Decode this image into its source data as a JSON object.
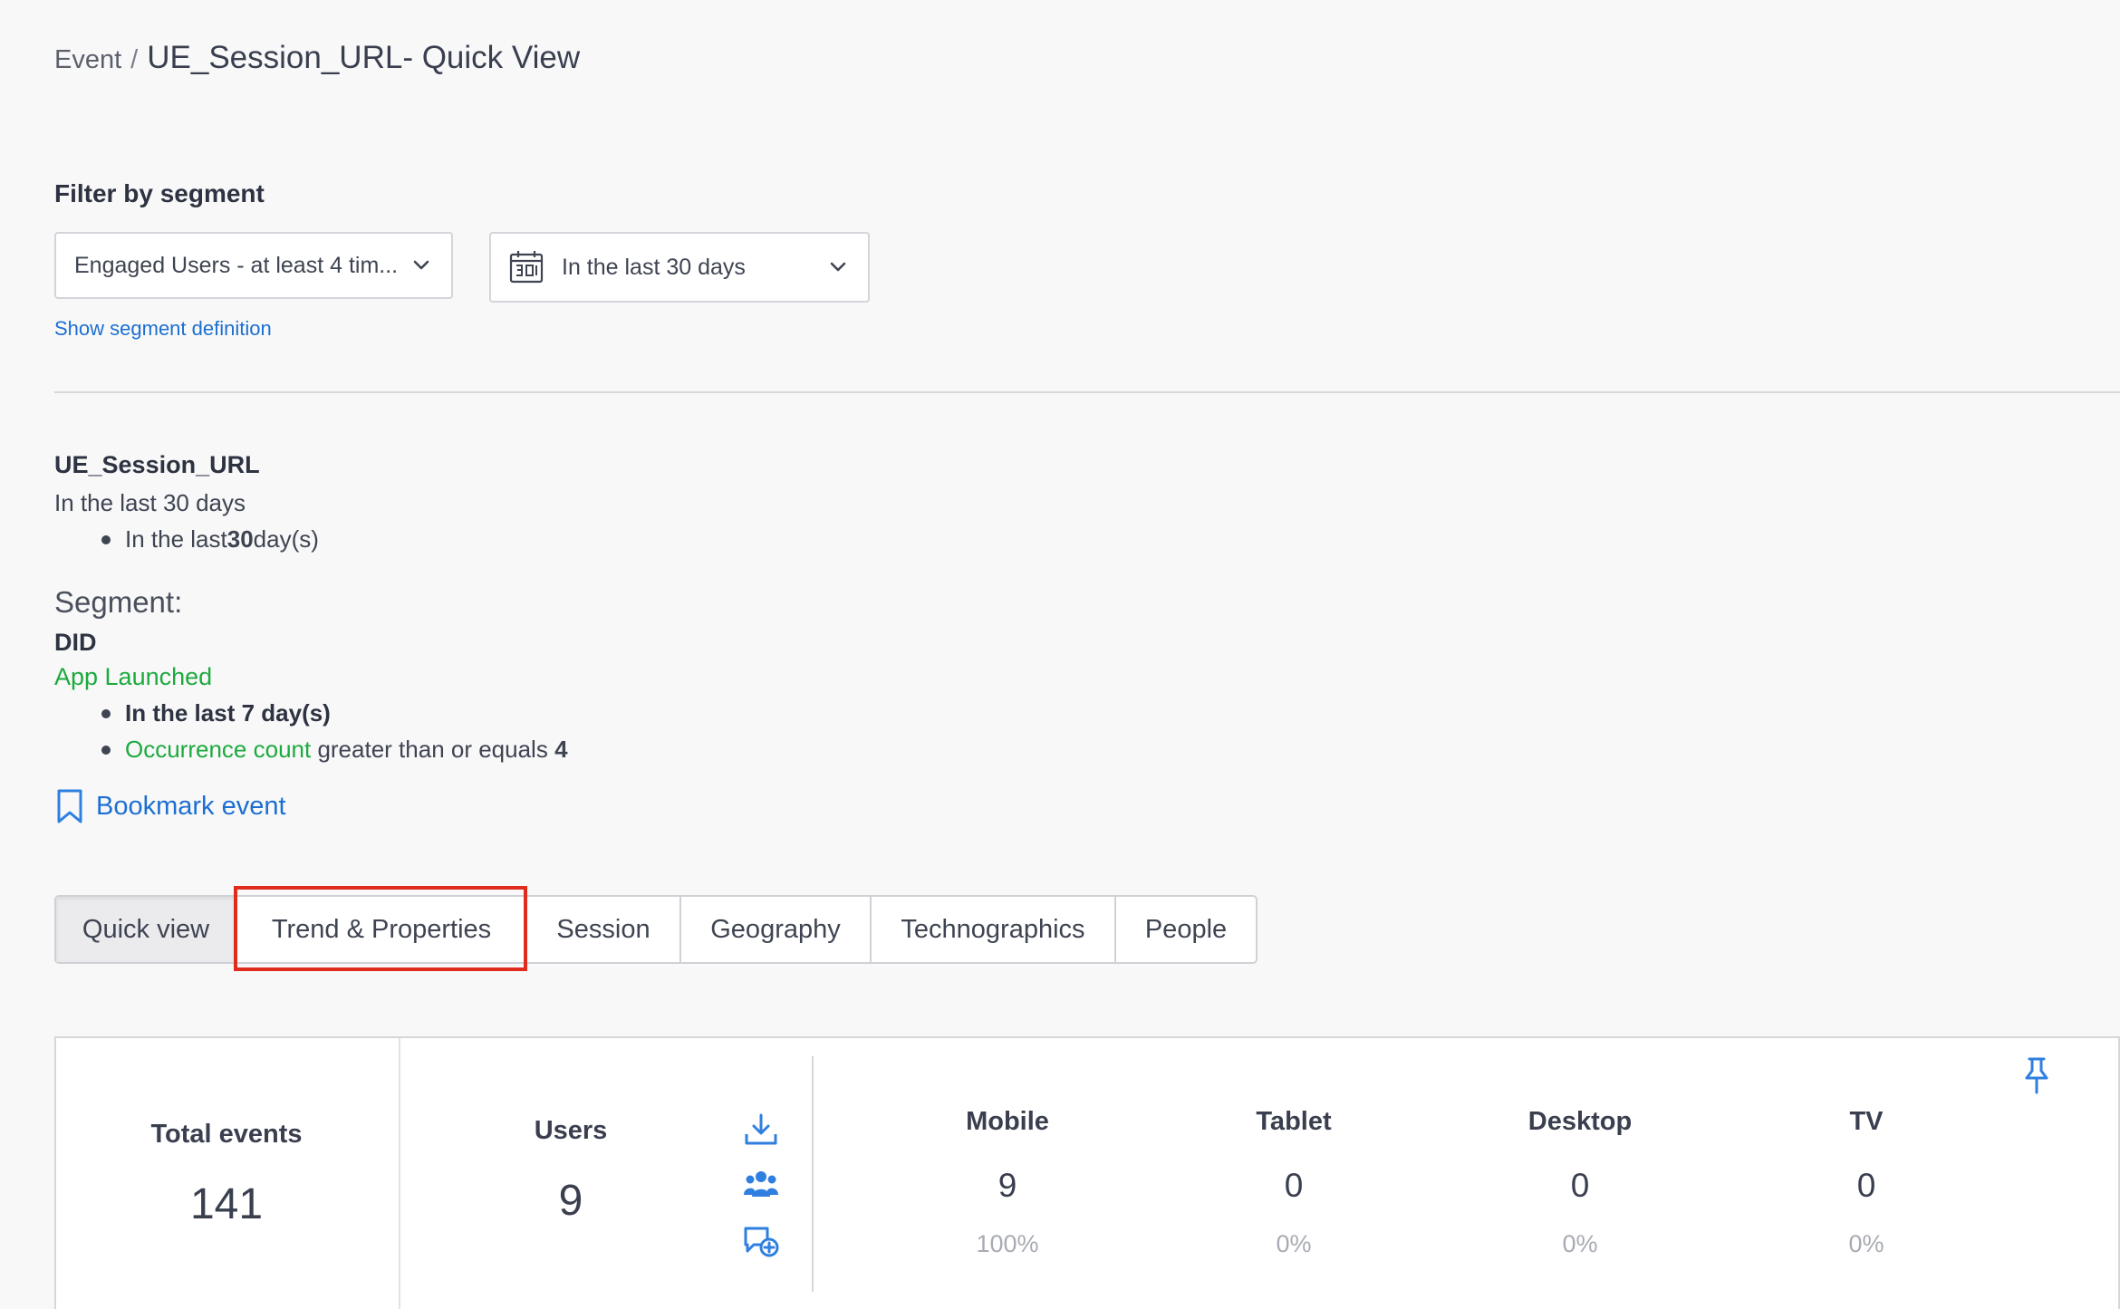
{
  "breadcrumb": {
    "root": "Event",
    "separator": "/",
    "title": "UE_Session_URL- Quick View"
  },
  "filter": {
    "label": "Filter by segment",
    "segment_value": "Engaged Users - at least 4 tim...",
    "date_value": "In the last 30 days",
    "segment_definition_link": "Show segment definition"
  },
  "event_summary": {
    "name": "UE_Session_URL",
    "range": "In the last 30 days",
    "range_detail_prefix": "In the last ",
    "range_detail_number": "30",
    "range_detail_suffix": " day(s)"
  },
  "segment": {
    "heading": "Segment:",
    "condition": "DID",
    "event": "App Launched",
    "time_rule": "In the last 7 day(s)",
    "count_label": "Occurrence count",
    "count_operator": " greater than or equals ",
    "count_value": "4"
  },
  "bookmark": {
    "label": "Bookmark event",
    "icon": "bookmark-icon"
  },
  "tabs": [
    {
      "label": "Quick view",
      "active": true
    },
    {
      "label": "Trend & Properties",
      "active": false
    },
    {
      "label": "Session",
      "active": false
    },
    {
      "label": "Geography",
      "active": false
    },
    {
      "label": "Technographics",
      "active": false
    },
    {
      "label": "People",
      "active": false
    }
  ],
  "stats": {
    "total_events": {
      "label": "Total events",
      "value": "141"
    },
    "users": {
      "label": "Users",
      "value": "9"
    },
    "devices": [
      {
        "label": "Mobile",
        "value": "9",
        "percent": "100%"
      },
      {
        "label": "Tablet",
        "value": "0",
        "percent": "0%"
      },
      {
        "label": "Desktop",
        "value": "0",
        "percent": "0%"
      },
      {
        "label": "TV",
        "value": "0",
        "percent": "0%"
      }
    ]
  },
  "colors": {
    "link": "#1c6fd1",
    "green": "#1daa3e",
    "highlight": "#e02b1d",
    "icon_blue": "#2f7fe0"
  }
}
